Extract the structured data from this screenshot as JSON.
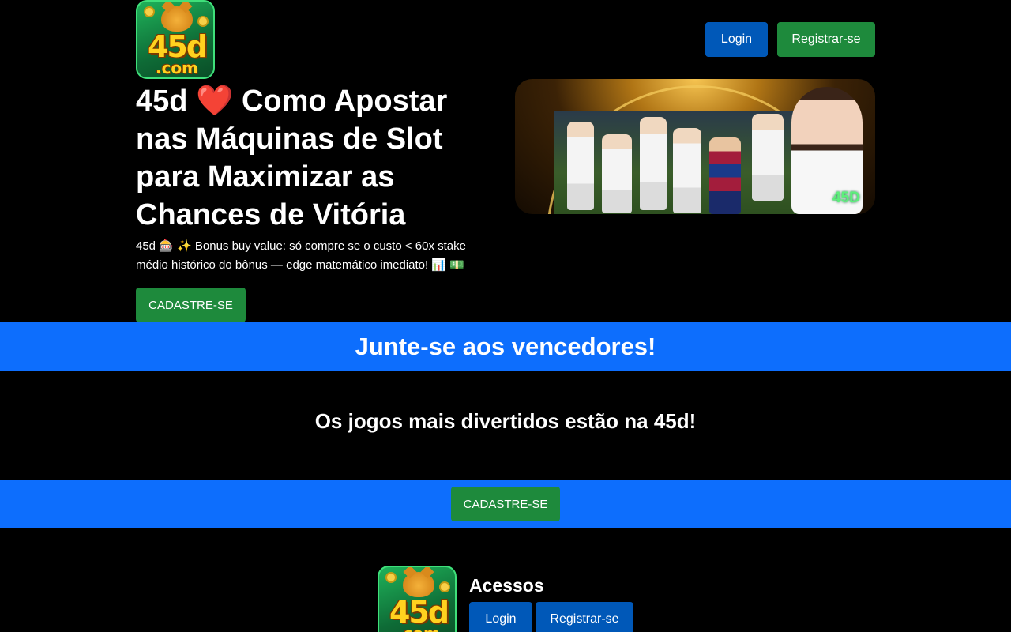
{
  "header": {
    "logo": {
      "main": "45d",
      "sub": ".com",
      "icon": "tiger-mascot-logo"
    },
    "login_label": "Login",
    "register_label": "Registrar-se"
  },
  "hero": {
    "title_prefix": "45d",
    "title_heart": "❤️",
    "title_main": "Como Apostar nas Máquinas de Slot para Maximizar as Chances de Vitória",
    "description": "45d 🎰 ✨ Bonus buy value: só compre se o custo < 60x stake médio histórico do bônus — edge matemático imediato! 📊 💵",
    "cta_label": "CADASTRE-SE",
    "banner": {
      "tag": "45D"
    }
  },
  "join_bar": {
    "title": "Junte-se aos vencedores!"
  },
  "games": {
    "text": "Os jogos mais divertidos estão na 45d!"
  },
  "cta_bar": {
    "label": "CADASTRE-SE"
  },
  "footer": {
    "heading": "Acessos",
    "login_label": "Login",
    "register_label": "Registrar-se"
  },
  "colors": {
    "background": "#000000",
    "primary_blue": "#0d6efd",
    "button_blue": "#0058b8",
    "button_green": "#1e8a3c",
    "heart": "#e8212a"
  }
}
